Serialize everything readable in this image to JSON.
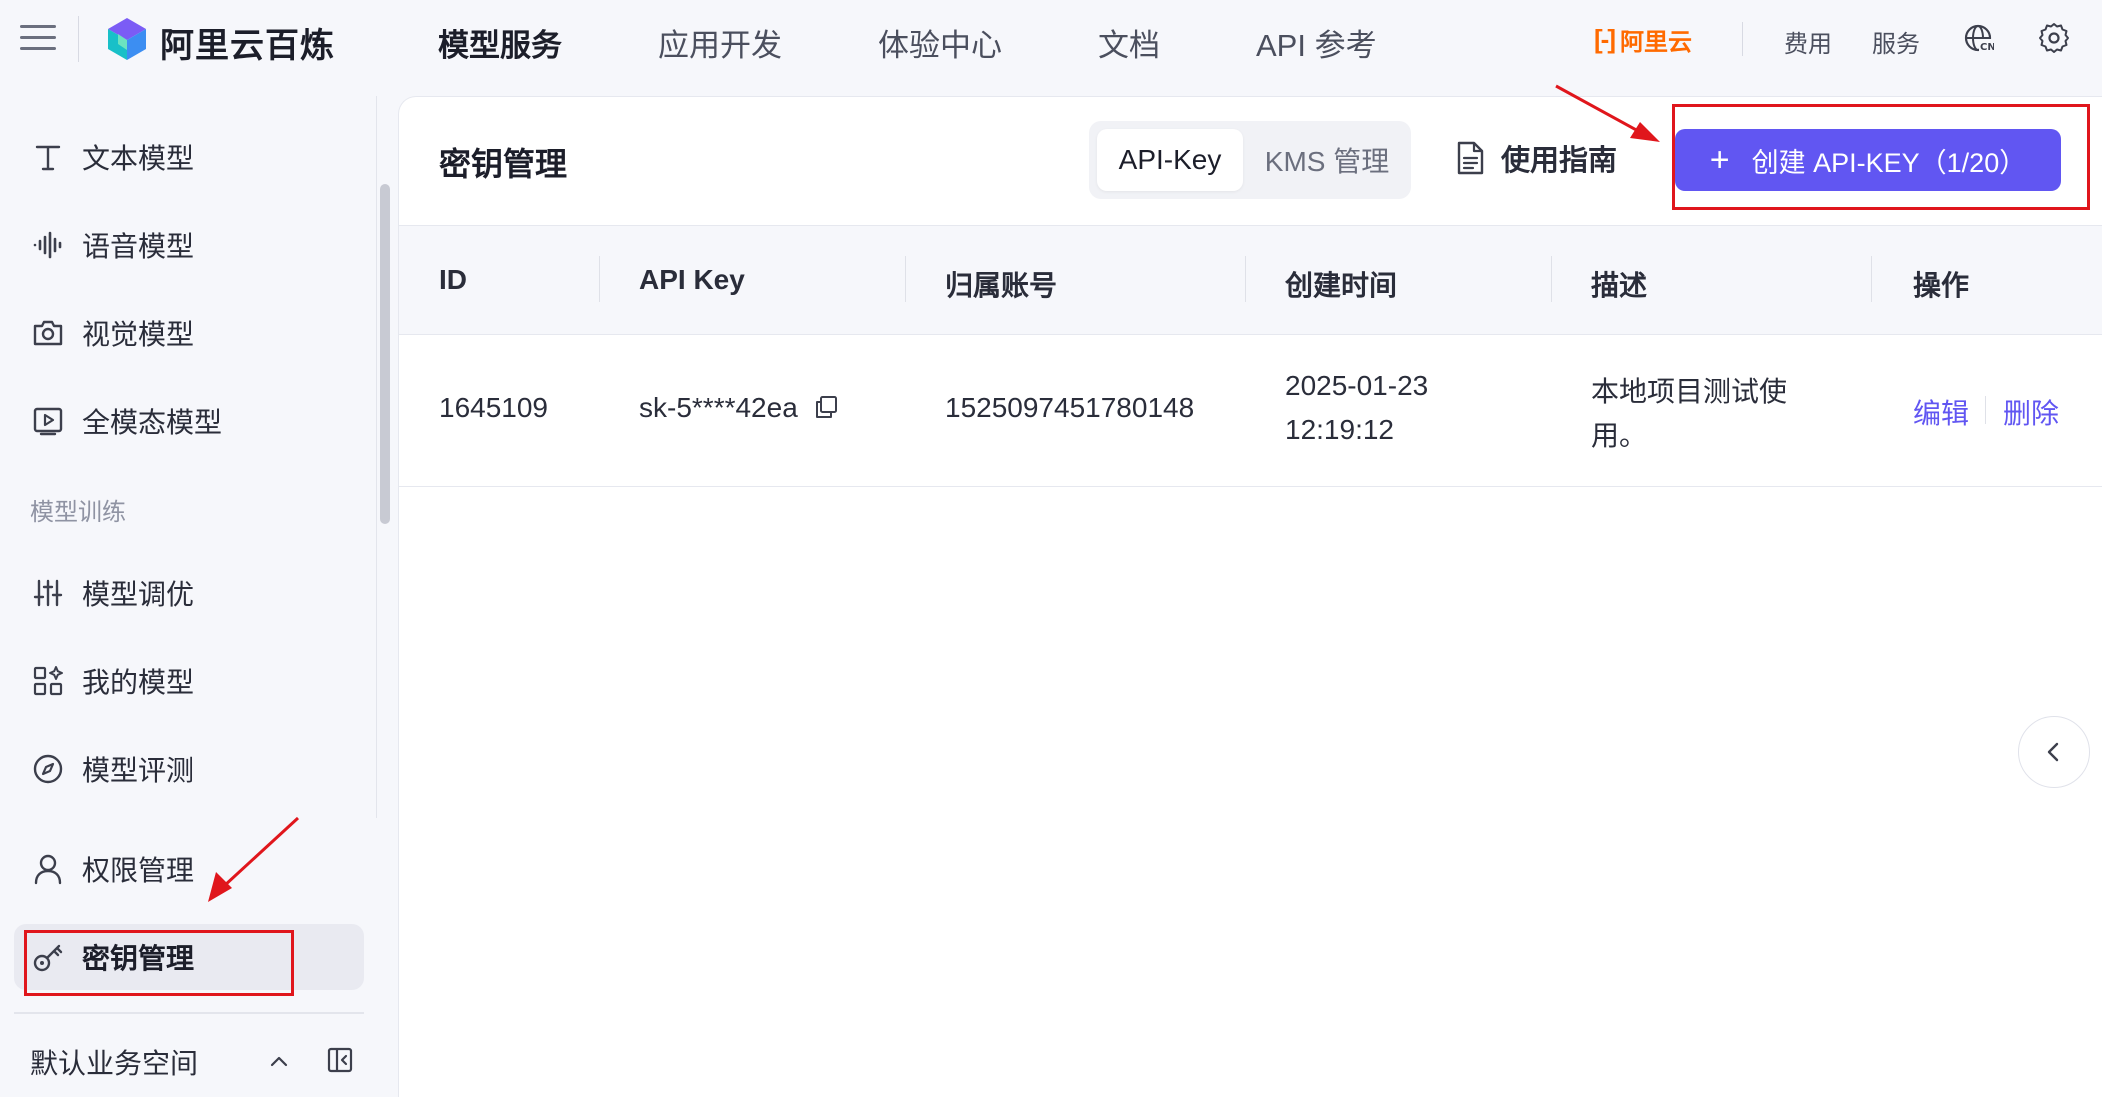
{
  "topbar": {
    "logo_text": "阿里云百炼",
    "nav": [
      {
        "label": "模型服务",
        "active": true
      },
      {
        "label": "应用开发",
        "active": false
      },
      {
        "label": "体验中心",
        "active": false
      },
      {
        "label": "文档",
        "active": false
      },
      {
        "label": "API 参考",
        "active": false
      }
    ],
    "brand_aliyun": "阿里云",
    "links": {
      "fees": "费用",
      "service": "服务"
    },
    "icons": [
      "language-icon",
      "settings-icon"
    ],
    "colors": {
      "brand_orange": "#ff6a00"
    }
  },
  "sidebar": {
    "items": [
      {
        "label": "文本模型",
        "icon": "text-icon"
      },
      {
        "label": "语音模型",
        "icon": "audio-wave-icon"
      },
      {
        "label": "视觉模型",
        "icon": "camera-icon"
      },
      {
        "label": "全模态模型",
        "icon": "video-play-icon"
      }
    ],
    "section_training": "模型训练",
    "training_items": [
      {
        "label": "模型调优",
        "icon": "sliders-icon"
      },
      {
        "label": "我的模型",
        "icon": "models-grid-icon"
      },
      {
        "label": "模型评测",
        "icon": "compass-icon"
      }
    ],
    "permission_item": {
      "label": "权限管理",
      "icon": "user-icon"
    },
    "key_item": {
      "label": "密钥管理",
      "icon": "key-icon",
      "active": true
    },
    "workspace": "默认业务空间"
  },
  "main": {
    "title": "密钥管理",
    "tabs": [
      {
        "label": "API-Key",
        "active": true
      },
      {
        "label": "KMS 管理",
        "active": false
      }
    ],
    "guide_label": "使用指南",
    "create_button": {
      "label": "创建 API-KEY（1/20）"
    },
    "accent_color": "#6156f2",
    "table": {
      "columns": [
        "ID",
        "API Key",
        "归属账号",
        "创建时间",
        "描述",
        "操作"
      ],
      "rows": [
        {
          "id": "1645109",
          "api_key": "sk-5****42ea",
          "account": "1525097451780148",
          "created_date": "2025-01-23",
          "created_time": "12:19:12",
          "description": "本地项目测试使用。",
          "actions": {
            "edit": "编辑",
            "delete": "删除"
          }
        }
      ]
    }
  },
  "annotation": {
    "highlight_color": "#e0161c"
  }
}
